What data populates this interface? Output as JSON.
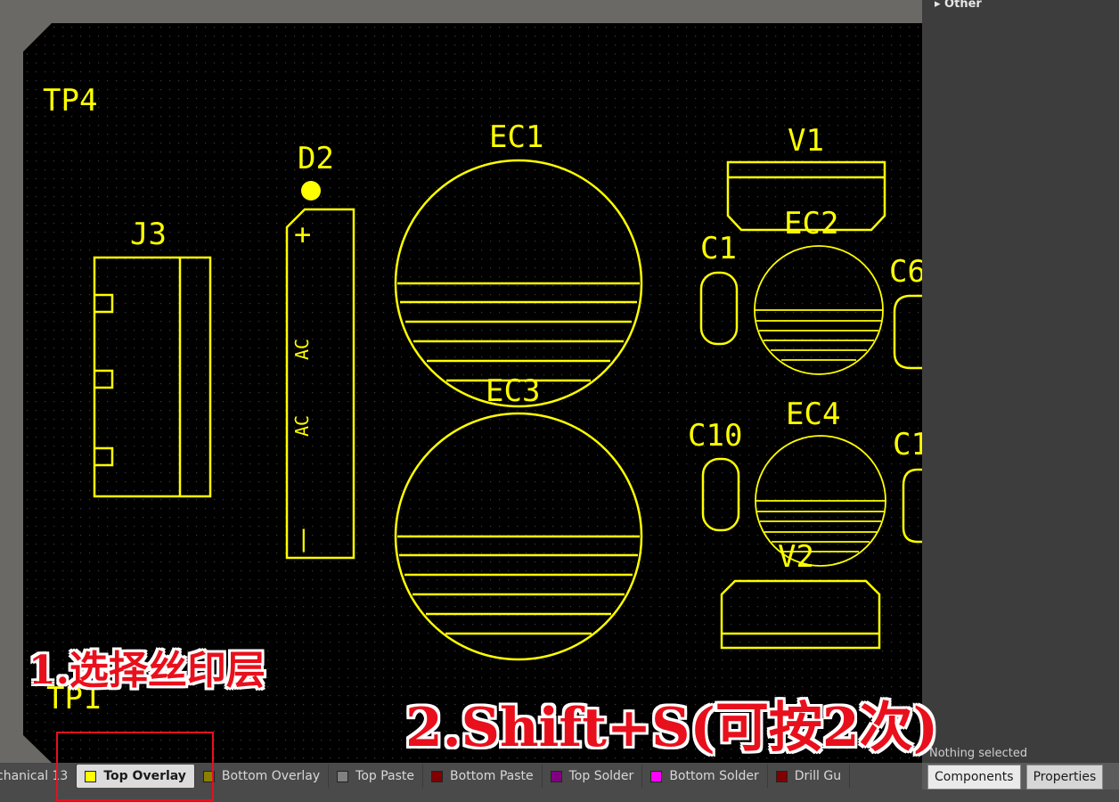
{
  "pcb": {
    "designators": {
      "tp4": "TP4",
      "tp1": "TP1",
      "j3": "J3",
      "d2": "D2",
      "ec1": "EC1",
      "ec3": "EC3",
      "v1": "V1",
      "ec2": "EC2",
      "c1": "C1",
      "c6": "C6",
      "c10": "C10",
      "ec4": "EC4",
      "c11": "C1",
      "v2": "V2"
    },
    "d2_marks": {
      "plus": "+",
      "ac_top": "AC",
      "ac_bottom": "AC",
      "minus": "|"
    },
    "colors": {
      "overlay": "#ffff00",
      "board": "#000000",
      "outside": "#6b6966"
    }
  },
  "right_panel": {
    "section_other": "▸ Other",
    "status": "Nothing selected"
  },
  "layer_tabs": [
    {
      "label": "chanical 13",
      "color": "#ff00ff"
    },
    {
      "label": "Top Overlay",
      "color": "#ffff00",
      "active": true
    },
    {
      "label": "Bottom Overlay",
      "color": "#8a7f00"
    },
    {
      "label": "Top Paste",
      "color": "#808080"
    },
    {
      "label": "Bottom Paste",
      "color": "#800000"
    },
    {
      "label": "Top Solder",
      "color": "#800080"
    },
    {
      "label": "Bottom Solder",
      "color": "#ff00ff"
    },
    {
      "label": "Drill Gu",
      "color": "#800000"
    }
  ],
  "panel_tabs": {
    "components": "Components",
    "properties": "Properties"
  },
  "annotations": {
    "step1": "1.选择丝印层",
    "step2": "2.Shift+S(可按2次)"
  }
}
